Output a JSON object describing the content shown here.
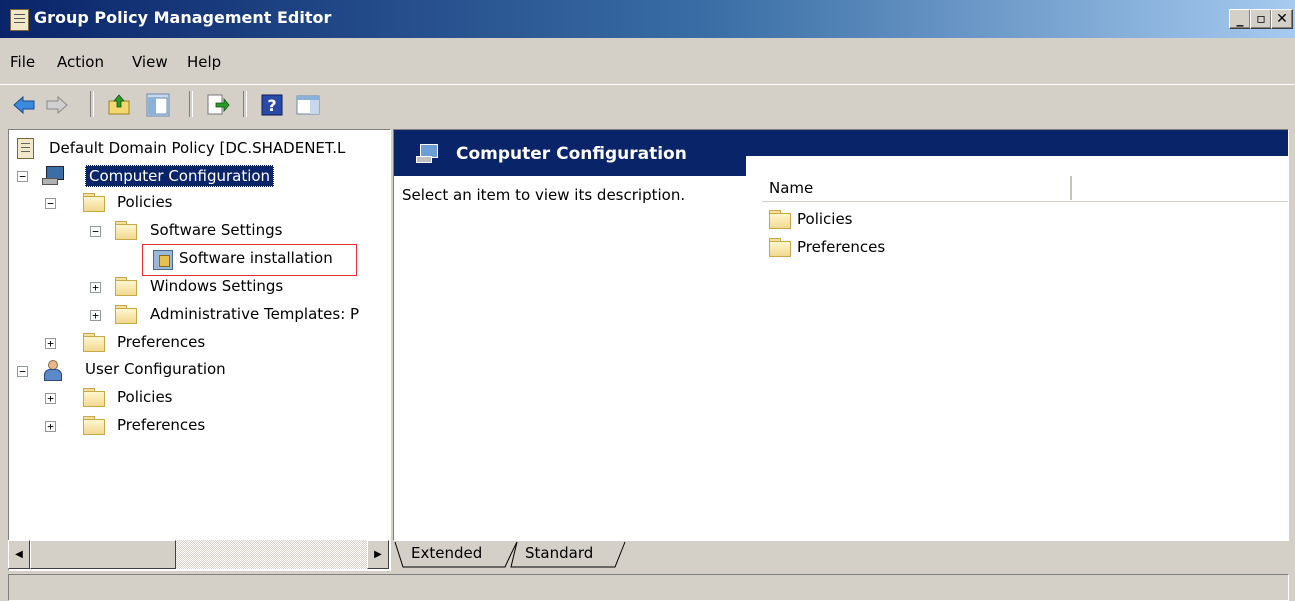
{
  "window": {
    "title": "Group Policy Management Editor",
    "controls": {
      "minimize": "_",
      "maximize": "▫",
      "close": "✕"
    }
  },
  "menu": {
    "items": [
      "File",
      "Action",
      "View",
      "Help"
    ]
  },
  "toolbar": {
    "icons": [
      "back-arrow-icon",
      "forward-arrow-icon",
      "up-folder-icon",
      "show-hide-tree-icon",
      "export-list-icon",
      "help-icon",
      "show-hide-action-pane-icon"
    ]
  },
  "tree": {
    "root": "Default Domain Policy [DC.SHADENET.L",
    "computer_config": "Computer Configuration",
    "cc_policies": "Policies",
    "software_settings": "Software Settings",
    "software_installation": "Software installation",
    "windows_settings": "Windows Settings",
    "admin_templates": "Administrative Templates: P",
    "cc_preferences": "Preferences",
    "user_config": "User Configuration",
    "uc_policies": "Policies",
    "uc_preferences": "Preferences"
  },
  "details": {
    "header_title": "Computer Configuration",
    "description": "Select an item to view its description.",
    "column_name": "Name",
    "items": [
      "Policies",
      "Preferences"
    ]
  },
  "tabs": {
    "extended": "Extended",
    "standard": "Standard"
  },
  "colors": {
    "title_bar": "#0a246a",
    "highlight_border": "#e03030",
    "selected_bg": "#0a246a",
    "folder": "#f3e09a"
  }
}
